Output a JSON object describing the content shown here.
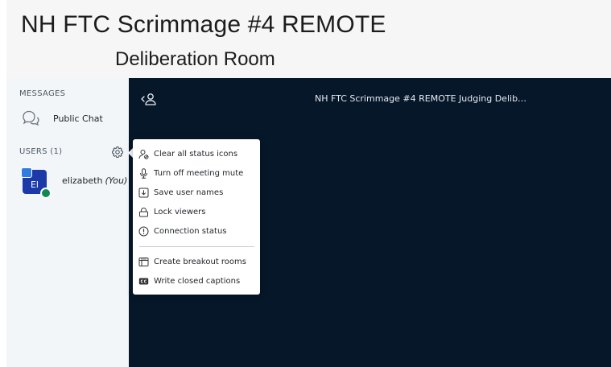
{
  "header": {
    "title": "NH FTC Scrimmage #4 REMOTE",
    "subtitle": "Deliberation Room"
  },
  "sidebar": {
    "messages_label": "MESSAGES",
    "public_chat": {
      "label": "Public Chat",
      "icon": "chat-icon"
    },
    "users_label": "USERS (1)",
    "settings_icon": "gear-icon",
    "users": [
      {
        "initials": "El",
        "name": "elizabeth",
        "you_label": "(You)",
        "avatar_color": "#1b3aa8"
      }
    ]
  },
  "main": {
    "back_icon": "back-user-icon",
    "meeting_title": "NH FTC Scrimmage #4 REMOTE Judging Delib…",
    "background": "#06172a"
  },
  "user_options_menu": {
    "items": [
      {
        "label": "Clear all status icons",
        "icon": "clear-status-icon"
      },
      {
        "label": "Turn off meeting mute",
        "icon": "microphone-icon"
      },
      {
        "label": "Save user names",
        "icon": "download-icon"
      },
      {
        "label": "Lock viewers",
        "icon": "lock-icon"
      },
      {
        "label": "Connection status",
        "icon": "warning-icon"
      }
    ],
    "items_secondary": [
      {
        "label": "Create breakout rooms",
        "icon": "breakout-rooms-icon"
      },
      {
        "label": "Write closed captions",
        "icon": "closed-captions-icon"
      }
    ]
  }
}
